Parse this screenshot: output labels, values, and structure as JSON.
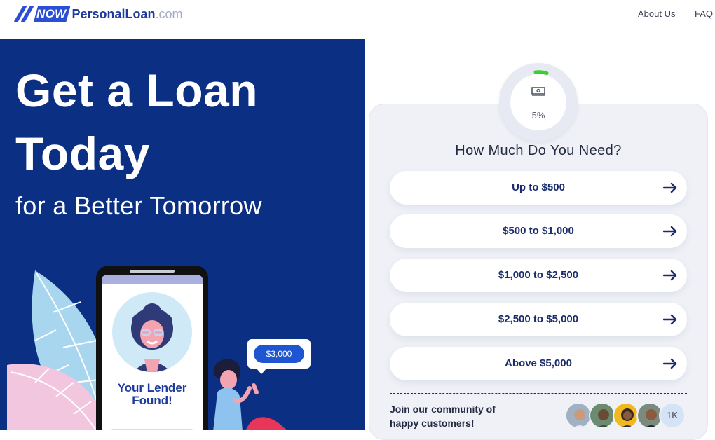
{
  "brand": {
    "now": "NOW",
    "personal": "Personal",
    "loan": "Loan",
    "com": ".com"
  },
  "nav": {
    "about": "About Us",
    "faq": "FAQ"
  },
  "hero": {
    "line1": "Get a Loan",
    "line2": "Today",
    "subtitle": "for a Better Tomorrow"
  },
  "illustration": {
    "lender_line1": "Your Lender",
    "lender_line2": "Found!",
    "bubble_amount": "$3,000"
  },
  "form": {
    "progress": "5%",
    "progress_value": 0.05,
    "title": "How Much Do You Need?",
    "options": [
      {
        "label": "Up to $500"
      },
      {
        "label": "$500 to $1,000"
      },
      {
        "label": "$1,000 to $2,500"
      },
      {
        "label": "$2,500 to $5,000"
      },
      {
        "label": "Above $5,000"
      }
    ],
    "community_line1": "Join our community of",
    "community_line2": "happy customers!",
    "customer_count": "1K"
  },
  "colors": {
    "brand_blue": "#2a4fd6",
    "hero_bg": "#0b2f82",
    "option_text": "#1a2b6c",
    "progress_green": "#3ccf2c"
  }
}
